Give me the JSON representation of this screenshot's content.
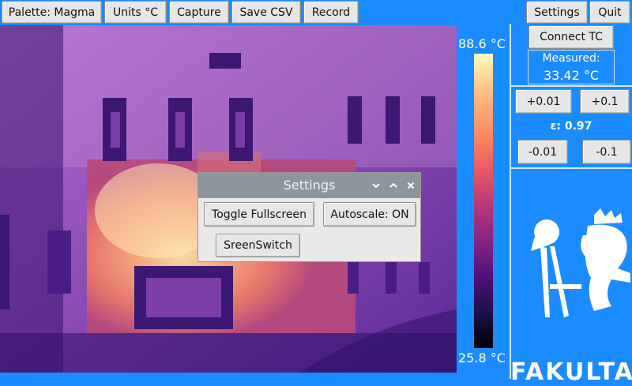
{
  "toolbar": {
    "palette_label": "Palette: Magma",
    "units_label": "Units °C",
    "capture_label": "Capture",
    "save_csv_label": "Save CSV",
    "record_label": "Record",
    "settings_label": "Settings",
    "quit_label": "Quit"
  },
  "colorbar": {
    "max_label": "88.6 °C",
    "min_label": "25.8 °C",
    "palette": "magma"
  },
  "side_panel": {
    "connect_tc_label": "Connect TC",
    "measured_label": "Measured:",
    "measured_value": "33.42 °C",
    "inc_small_label": "+0.01",
    "inc_large_label": "+0.1",
    "emissivity_label": "ε: 0.97",
    "dec_small_label": "-0.01",
    "dec_large_label": "-0.1",
    "logo_text": "FAKULTA"
  },
  "settings_dialog": {
    "title": "Settings",
    "minimize_icon": "chevron-down-icon",
    "maximize_icon": "chevron-up-icon",
    "close_icon": "close-icon",
    "toggle_fullscreen_label": "Toggle Fullscreen",
    "autoscale_label": "Autoscale: ON",
    "screen_switch_label": "SreenSwitch"
  },
  "colors": {
    "background": "#1a8cff",
    "button_bg": "#e6e6e6",
    "dialog_title_bg": "#8d969c"
  }
}
